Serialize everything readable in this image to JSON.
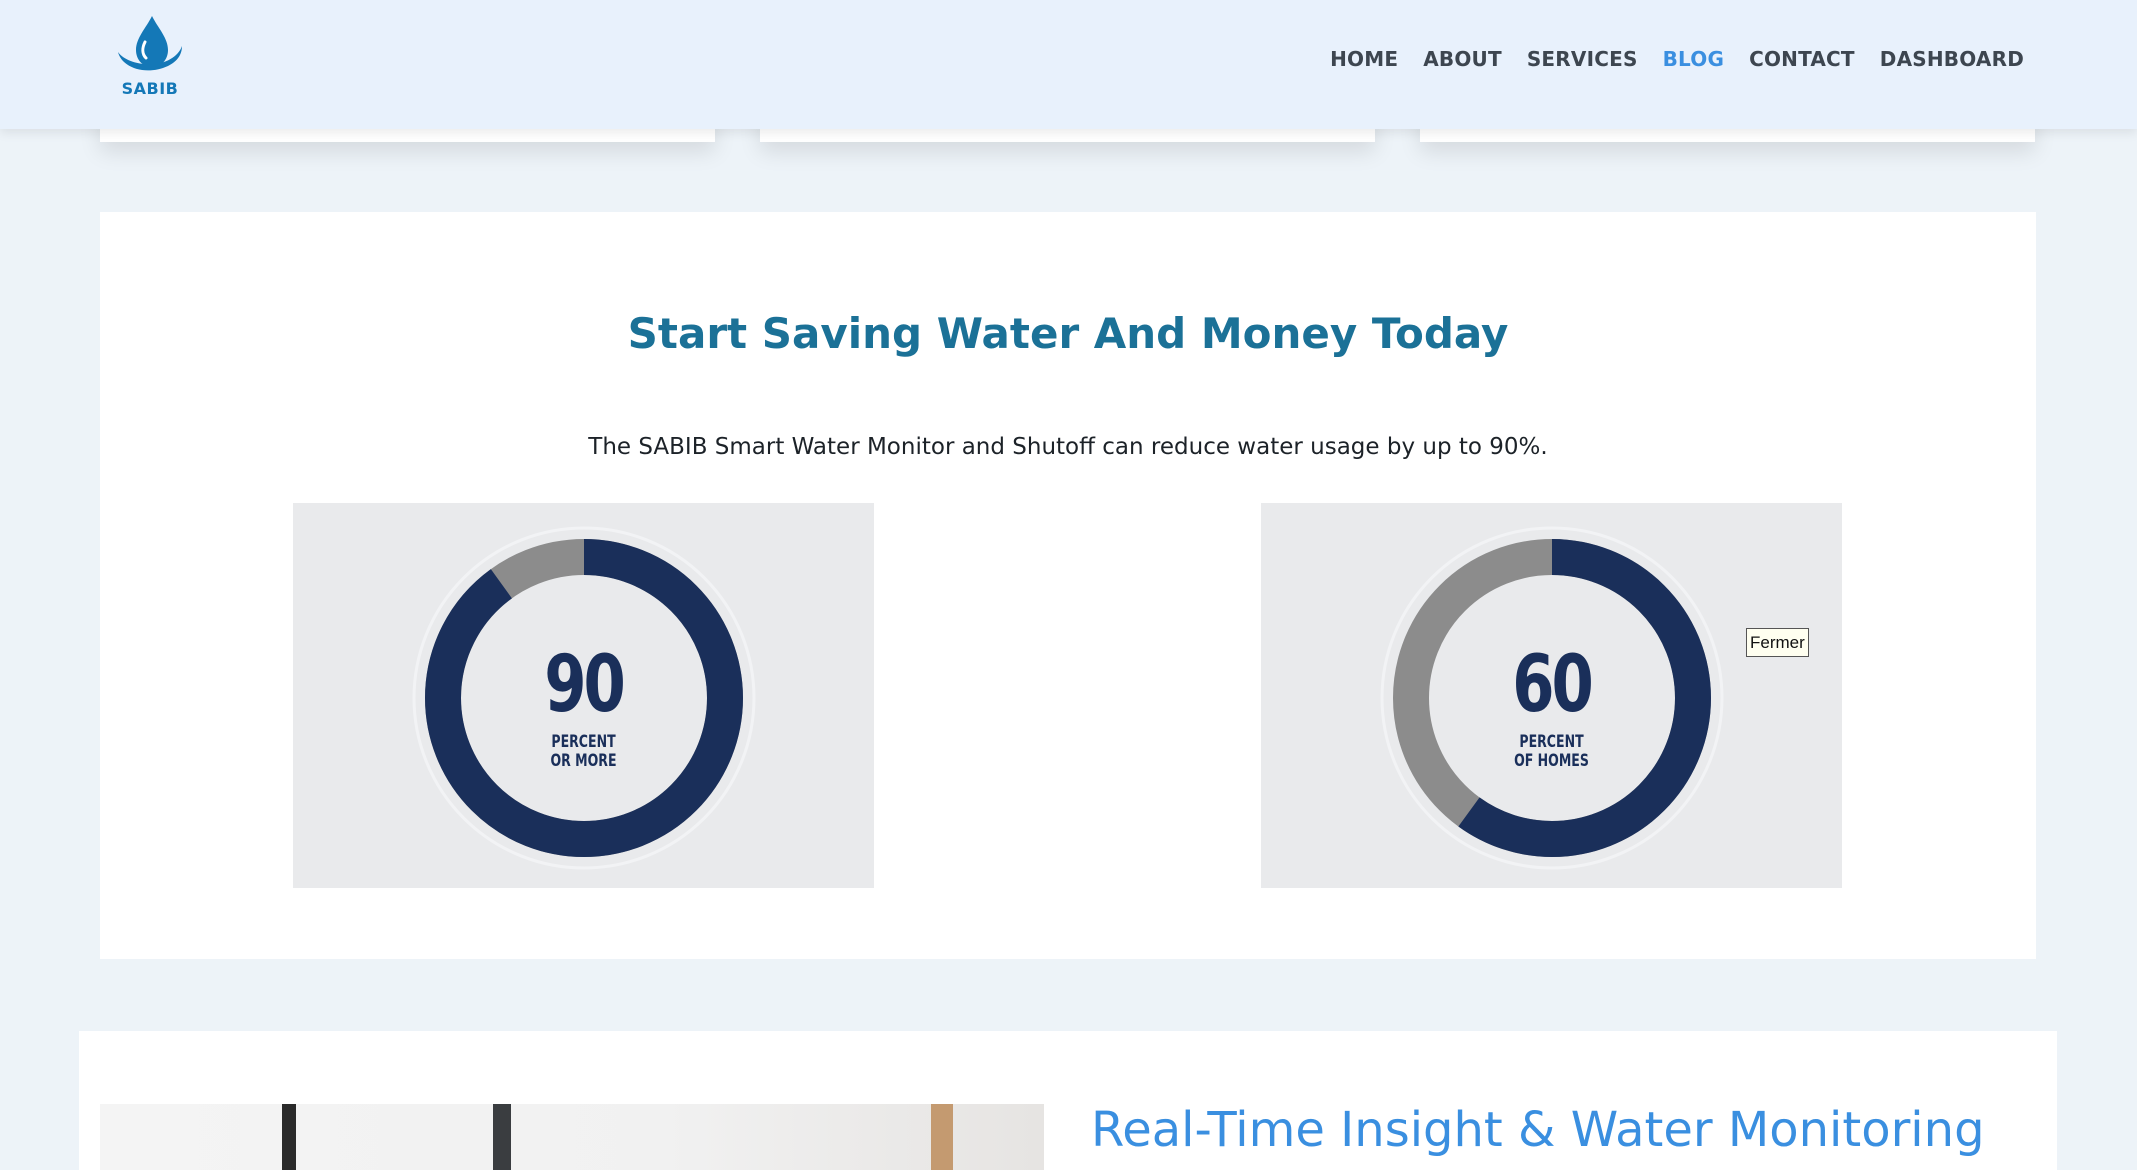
{
  "header": {
    "logo_text": "SABIB",
    "nav": [
      {
        "label": "HOME",
        "active": false
      },
      {
        "label": "ABOUT",
        "active": false
      },
      {
        "label": "SERVICES",
        "active": false
      },
      {
        "label": "BLOG",
        "active": true
      },
      {
        "label": "CONTACT",
        "active": false
      },
      {
        "label": "DASHBOARD",
        "active": false
      }
    ]
  },
  "savings": {
    "title": "Start Saving Water And Money Today",
    "description": "The SABIB Smart Water Monitor and Shutoff can reduce water usage by up to 90%.",
    "donuts": [
      {
        "number": "90",
        "caption_line1": "PERCENT",
        "caption_line2": "OR MORE",
        "percent": 90
      },
      {
        "number": "60",
        "caption_line1": "PERCENT",
        "caption_line2": "OF HOMES",
        "percent": 60
      }
    ]
  },
  "tooltip": {
    "text": "Fermer"
  },
  "realtime": {
    "title": "Real-Time Insight & Water Monitoring"
  },
  "colors": {
    "accent": "#3a8fe0",
    "title": "#1b7197",
    "donut_fill": "#1a2f5a",
    "donut_rest": "#8c8c8c"
  }
}
